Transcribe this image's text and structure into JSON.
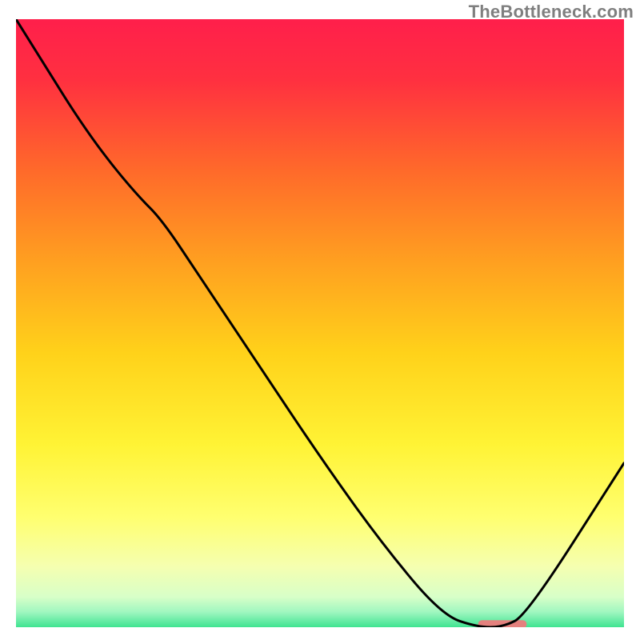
{
  "watermark": "TheBottleneck.com",
  "chart_data": {
    "type": "line",
    "x": [
      0.0,
      0.05,
      0.1,
      0.15,
      0.2,
      0.24,
      0.3,
      0.4,
      0.5,
      0.6,
      0.7,
      0.76,
      0.8,
      0.84,
      1.0
    ],
    "values": [
      1.0,
      0.92,
      0.84,
      0.77,
      0.71,
      0.67,
      0.58,
      0.43,
      0.28,
      0.14,
      0.02,
      0.0,
      0.0,
      0.02,
      0.27
    ],
    "xlim": [
      0,
      1
    ],
    "ylim": [
      0,
      1
    ],
    "title": "",
    "xlabel": "",
    "ylabel": "",
    "gradient_stops": [
      {
        "offset": 0.0,
        "color": "#ff1f4b"
      },
      {
        "offset": 0.1,
        "color": "#ff3040"
      },
      {
        "offset": 0.25,
        "color": "#ff6a2a"
      },
      {
        "offset": 0.4,
        "color": "#ffa020"
      },
      {
        "offset": 0.55,
        "color": "#ffd21a"
      },
      {
        "offset": 0.7,
        "color": "#fff335"
      },
      {
        "offset": 0.82,
        "color": "#ffff70"
      },
      {
        "offset": 0.9,
        "color": "#f5ffb0"
      },
      {
        "offset": 0.95,
        "color": "#d8ffc8"
      },
      {
        "offset": 0.975,
        "color": "#a0f7c0"
      },
      {
        "offset": 1.0,
        "color": "#3fe491"
      }
    ],
    "marker": {
      "x0": 0.76,
      "x1": 0.84,
      "y": 0.005,
      "color": "#e4817e"
    },
    "line_color": "#000000",
    "line_width": 3
  }
}
